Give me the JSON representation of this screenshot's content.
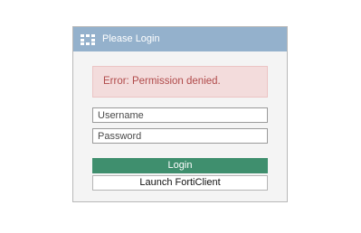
{
  "login_panel": {
    "header": {
      "logo_icon": "fortinet-logo-icon",
      "title": "Please Login"
    },
    "error_message": "Error: Permission denied.",
    "username": {
      "value": "",
      "placeholder": "Username"
    },
    "password": {
      "value": "",
      "placeholder": "Password"
    },
    "login_button_label": "Login",
    "launch_button_label": "Launch FortiClient"
  },
  "colors": {
    "header_bg": "#94b1cc",
    "error_bg": "#f3dcdc",
    "error_text": "#b04a4a",
    "login_button_bg": "#3f8f6e"
  }
}
